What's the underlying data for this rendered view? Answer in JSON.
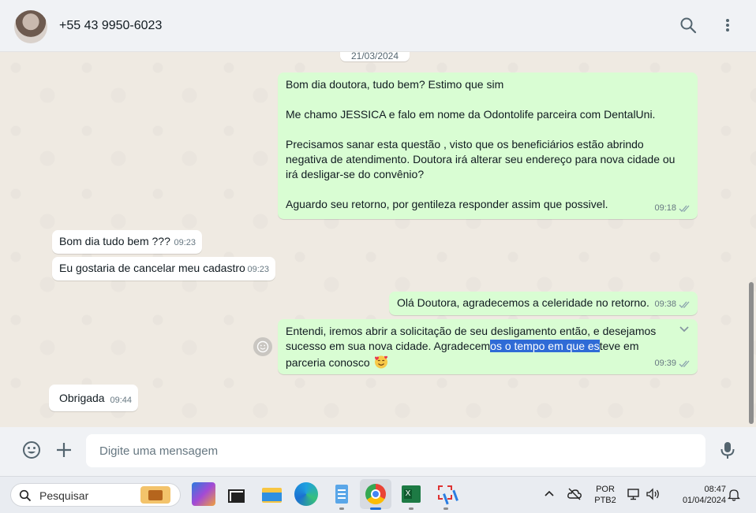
{
  "header": {
    "contact_name": "+55 43 9950-6023",
    "icons": [
      "search-icon",
      "menu-kebab-icon"
    ]
  },
  "chat": {
    "date_chip": "21/03/2024",
    "messages": [
      {
        "direction": "out",
        "text": "Bom dia doutora, tudo bem? Estimo que sim\n\nMe chamo JESSICA e falo em nome da Odontolife parceira com DentalUni.\n\nPrecisamos sanar esta questão , visto que os beneficiários estão abrindo negativa de atendimento. Doutora irá alterar seu endereço para nova cidade ou irá desligar-se do convênio?\n\nAguardo seu retorno, por gentileza responder assim que possivel.",
        "time": "09:18",
        "status": "read"
      },
      {
        "direction": "in",
        "text": "Bom dia tudo bem ???",
        "time": "09:23"
      },
      {
        "direction": "in",
        "text": "Eu gostaria de cancelar meu cadastro",
        "time": "09:23"
      },
      {
        "direction": "out",
        "text": "Olá Doutora, agradecemos a celeridade no retorno.",
        "time": "09:38",
        "status": "read"
      },
      {
        "direction": "out",
        "text_before": "Entendi, iremos abrir a solicitação de seu desligamento então, e desejamos sucesso em sua nova cidade. Agradecem",
        "text_selected": "os o tempo em que es",
        "text_after": "teve em parceria conosco ",
        "emoji": "smiling-face-with-hearts-emoji",
        "time": "09:39",
        "status": "read"
      },
      {
        "direction": "in",
        "text": "Obrigada",
        "time": "09:44"
      }
    ]
  },
  "compose": {
    "placeholder": "Digite uma mensagem",
    "icons": [
      "emoji-icon",
      "plus-icon",
      "mic-icon"
    ]
  },
  "taskbar": {
    "search_label": "Pesquisar",
    "language_line1": "POR",
    "language_line2": "PTB2",
    "time": "08:47",
    "date": "01/04/2024"
  },
  "colors": {
    "outgoing_bubble": "#d9fdd3",
    "incoming_bubble": "#ffffff",
    "read_ticks": "#53bdeb",
    "chat_bg": "#efeae2",
    "selection": "#2f6bd6"
  }
}
